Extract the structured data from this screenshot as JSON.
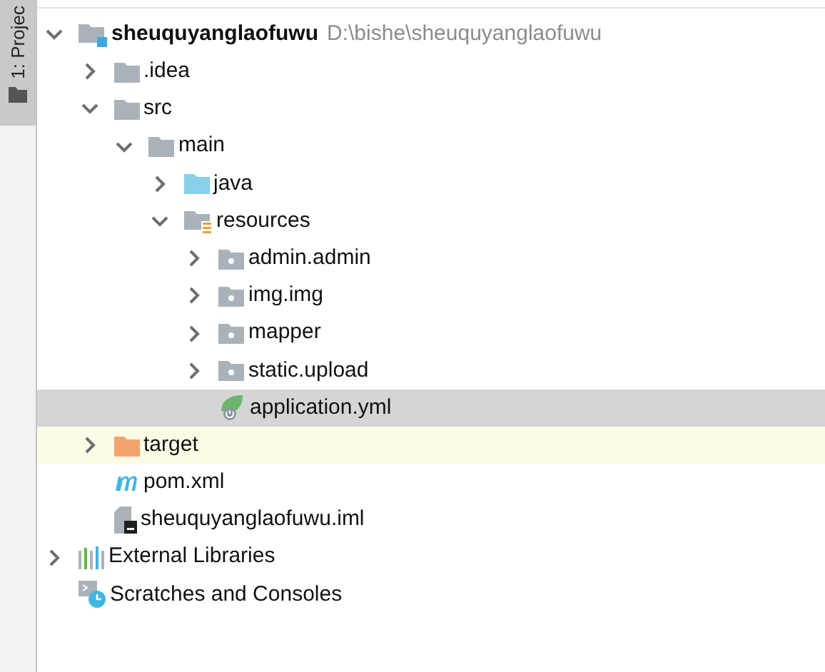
{
  "side_tab": {
    "label": "1: Projec",
    "selected": true
  },
  "tree": [
    {
      "label": "sheuquyanglaofuwu",
      "path": "D:\\bishe\\sheuquyanglaofuwu",
      "kind": "module",
      "expanded": true,
      "selected": false,
      "children": [
        {
          "label": ".idea",
          "kind": "folder",
          "expanded": false,
          "selected": false
        },
        {
          "label": "src",
          "kind": "folder",
          "expanded": true,
          "selected": false,
          "children": [
            {
              "label": "main",
              "kind": "folder",
              "expanded": true,
              "selected": false,
              "children": [
                {
                  "label": "java",
                  "kind": "source",
                  "expanded": false,
                  "selected": false
                },
                {
                  "label": "resources",
                  "kind": "resources",
                  "expanded": true,
                  "selected": false,
                  "children": [
                    {
                      "label": "admin.admin",
                      "kind": "package",
                      "expanded": false,
                      "selected": false
                    },
                    {
                      "label": "img.img",
                      "kind": "package",
                      "expanded": false,
                      "selected": false
                    },
                    {
                      "label": "mapper",
                      "kind": "package",
                      "expanded": false,
                      "selected": false
                    },
                    {
                      "label": "static.upload",
                      "kind": "package",
                      "expanded": false,
                      "selected": false
                    },
                    {
                      "label": "application.yml",
                      "kind": "spring",
                      "selected": true
                    }
                  ]
                }
              ]
            }
          ]
        },
        {
          "label": "target",
          "kind": "excluded",
          "expanded": false,
          "selected": false
        },
        {
          "label": "pom.xml",
          "kind": "maven",
          "selected": false
        },
        {
          "label": "sheuquyanglaofuwu.iml",
          "kind": "iml",
          "selected": false
        }
      ]
    },
    {
      "label": "External Libraries",
      "kind": "libraries",
      "expanded": false,
      "selected": false
    },
    {
      "label": "Scratches and Consoles",
      "kind": "scratches",
      "selected": false
    }
  ]
}
